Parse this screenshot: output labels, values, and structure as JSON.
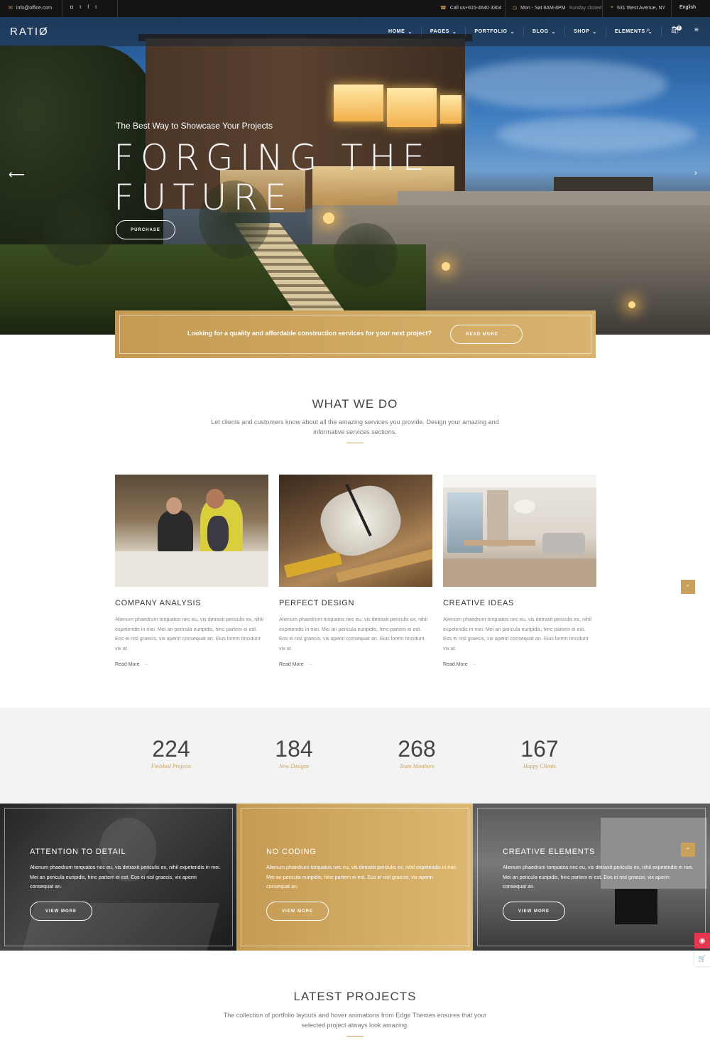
{
  "topbar": {
    "email": "info@office.com",
    "phone": "Call us+615-4640 3304",
    "hours": "Mon - Sat 8AM-8PM",
    "hours_closed": "Sunday closed",
    "address": "531 West Avenue, NY",
    "language": "English"
  },
  "header": {
    "logo": "RATIØ",
    "nav": [
      "HOME",
      "PAGES",
      "PORTFOLIO",
      "BLOG",
      "SHOP",
      "ELEMENTS"
    ],
    "cart_count": "0"
  },
  "hero": {
    "tagline": "The Best Way to Showcase Your Projects",
    "title": "FORGING THE FUTURE",
    "button": "PURCHASE"
  },
  "cta": {
    "text": "Looking for a quality and affordable construction services for your next project?",
    "button": "READ MORE"
  },
  "what_we_do": {
    "title": "WHAT WE DO",
    "subtitle": "Let clients and customers know about all the amazing services you provide. Design your amazing and informative services sections.",
    "cards": [
      {
        "title": "COMPANY ANALYSIS",
        "text": "Alienum phaedrum torquatos nec eu, vis detraxit periculis ex, nihil expetendis in mei. Mei an pericula euripidis, hinc partem ei est. Eos ei nisl graecis, vix aperiri consequat an. Eius lorem tincidunt vix at.",
        "link": "Read More"
      },
      {
        "title": "PERFECT DESIGN",
        "text": "Alienum phaedrum torquatos nec eu, vis detraxit periculis ex, nihil expetendis in mei. Mei an pericula euripidis, hinc partem ei est. Eos ei nisl graecis, vix aperiri consequat an. Eius lorem tincidunt vix at.",
        "link": "Read More"
      },
      {
        "title": "CREATIVE IDEAS",
        "text": "Alienum phaedrum torquatos nec eu, vis detraxit periculis ex, nihil expetendis in mei. Mei an pericula euripidis, hinc partem ei est. Eos ei nisl graecis, vix aperiri consequat an. Eius lorem tincidunt vix at.",
        "link": "Read More"
      }
    ]
  },
  "counters": [
    {
      "value": "224",
      "label": "Finished Projects"
    },
    {
      "value": "184",
      "label": "New Designs"
    },
    {
      "value": "268",
      "label": "Team Members"
    },
    {
      "value": "167",
      "label": "Happy Clients"
    }
  ],
  "panels": [
    {
      "title": "ATTENTION TO DETAIL",
      "text": "Alienum phaedrum torquatos nec eu, vis detraxit periculis ex, nihil expetendis in mei. Mei an pericula euripidis, hinc partem ei est. Eos ei nisl graecis, vix aperiri consequat an.",
      "button": "VIEW MORE"
    },
    {
      "title": "NO CODING",
      "text": "Alienum phaedrum torquatos nec eu, vis detraxit periculis ex, nihil expetendis in mei. Mei an pericula euripidis, hinc partem ei est. Eos ei nisl graecis, vix aperiri consequat an.",
      "button": "VIEW MORE"
    },
    {
      "title": "CREATIVE ELEMENTS",
      "text": "Alienum phaedrum torquatos nec eu, vis detraxit periculis ex, nihil expetendis in mei. Mei an pericula euripidis, hinc partem ei est. Eos ei nisl graecis, vix aperiri consequat an.",
      "button": "VIEW MORE"
    }
  ],
  "latest_projects": {
    "title": "LATEST PROJECTS",
    "subtitle": "The collection of portfolio layouts and hover animations from Edge Themes ensures that your selected project always look amazing."
  },
  "colors": {
    "accent": "#c9a15a",
    "topbar": "#141414",
    "counters_bg": "#f3f3f3"
  },
  "icons": [
    "mail-icon",
    "instagram-icon",
    "twitter-icon",
    "facebook-icon",
    "tumblr-icon",
    "phone-icon",
    "clock-icon",
    "pin-icon",
    "search-icon",
    "cart-icon",
    "menu-icon",
    "arrow-left-icon",
    "arrow-right-icon",
    "back-to-top-icon"
  ]
}
